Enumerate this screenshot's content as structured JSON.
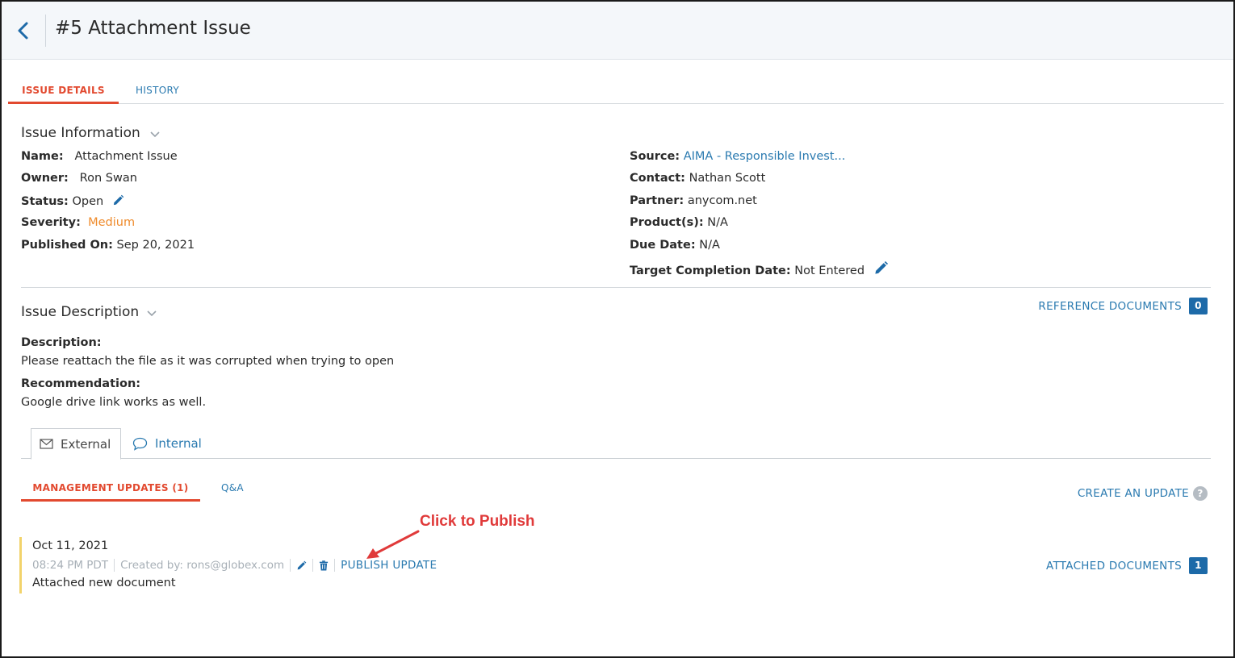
{
  "header": {
    "title": "#5 Attachment Issue"
  },
  "tabs": {
    "issue_details": "ISSUE DETAILS",
    "history": "HISTORY"
  },
  "issue_info": {
    "title": "Issue Information",
    "left": [
      {
        "label": "Name:",
        "value": "Attachment Issue"
      },
      {
        "label": "Owner:",
        "value": "Ron Swan"
      },
      {
        "label": "Status:",
        "value": "Open"
      },
      {
        "label": "Severity:",
        "value": "Medium"
      },
      {
        "label": "Published On:",
        "value": "Sep 20, 2021"
      }
    ],
    "right": [
      {
        "label": "Source:",
        "value": "AIMA - Responsible Invest..."
      },
      {
        "label": "Contact:",
        "value": "Nathan Scott"
      },
      {
        "label": "Partner:",
        "value": "anycom.net"
      },
      {
        "label": "Product(s):",
        "value": "N/A"
      },
      {
        "label": "Due Date:",
        "value": "N/A"
      },
      {
        "label": "Target Completion Date:",
        "value": "Not Entered"
      }
    ]
  },
  "issue_desc": {
    "title": "Issue Description",
    "ref_docs_label": "REFERENCE DOCUMENTS",
    "ref_docs_count": "0",
    "description_label": "Description:",
    "description": "Please reattach the file as it was corrupted when trying to open",
    "recommendation_label": "Recommendation:",
    "recommendation": "Google drive link works as well."
  },
  "comm_tabs": {
    "external": "External",
    "internal": "Internal"
  },
  "updates": {
    "tab_management": "MANAGEMENT UPDATES (1)",
    "tab_qa": "Q&A",
    "create_label": "CREATE AN UPDATE",
    "help": "?",
    "item": {
      "date": "Oct 11, 2021",
      "time": "08:24 PM PDT",
      "created_by": "Created by: rons@globex.com",
      "publish_label": "PUBLISH UPDATE",
      "body": "Attached new document",
      "attached_label": "ATTACHED DOCUMENTS",
      "attached_count": "1"
    }
  },
  "annotation": {
    "callout": "Click to Publish"
  },
  "colors": {
    "accent_red": "#e2492f",
    "link_blue": "#2a7ab0",
    "badge_blue": "#1d6aa8",
    "severity_orange": "#ef8b2c",
    "update_bar": "#f2d36b",
    "callout_red": "#e03a3a"
  },
  "icons": [
    "chevron-left-icon",
    "chevron-down-icon",
    "pencil-icon",
    "envelope-icon",
    "speech-bubble-icon",
    "trash-icon",
    "help-icon"
  ]
}
